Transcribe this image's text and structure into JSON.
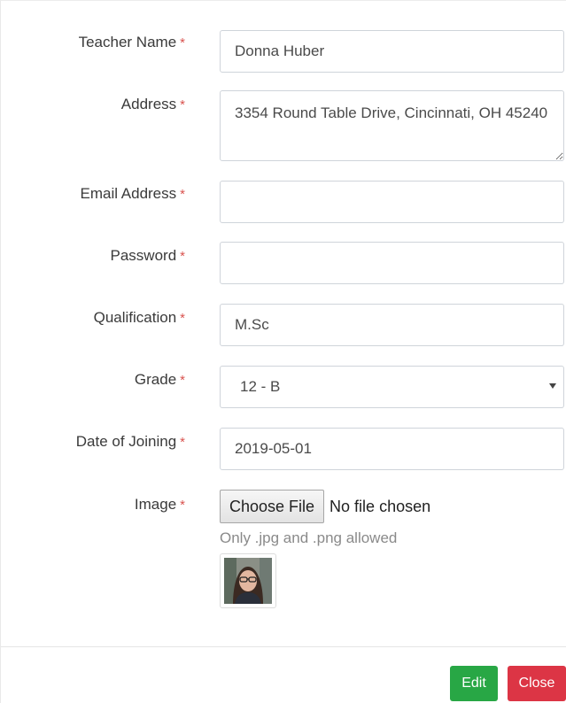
{
  "form": {
    "required_mark": "*",
    "teacher_name": {
      "label": "Teacher Name",
      "value": "Donna Huber"
    },
    "address": {
      "label": "Address",
      "value": "3354 Round Table Drive, Cincinnati, OH 45240"
    },
    "email": {
      "label": "Email Address",
      "value": ""
    },
    "password": {
      "label": "Password",
      "value": ""
    },
    "qualification": {
      "label": "Qualification",
      "value": "M.Sc"
    },
    "grade": {
      "label": "Grade",
      "value": "12 - B"
    },
    "date_of_joining": {
      "label": "Date of Joining",
      "value": "2019-05-01"
    },
    "image": {
      "label": "Image",
      "button_label": "Choose File",
      "status": "No file chosen",
      "hint": "Only .jpg and .png allowed"
    }
  },
  "footer": {
    "edit_label": "Edit",
    "close_label": "Close"
  },
  "colors": {
    "required": "#d9534f",
    "edit": "#28a745",
    "close": "#dc3545"
  }
}
